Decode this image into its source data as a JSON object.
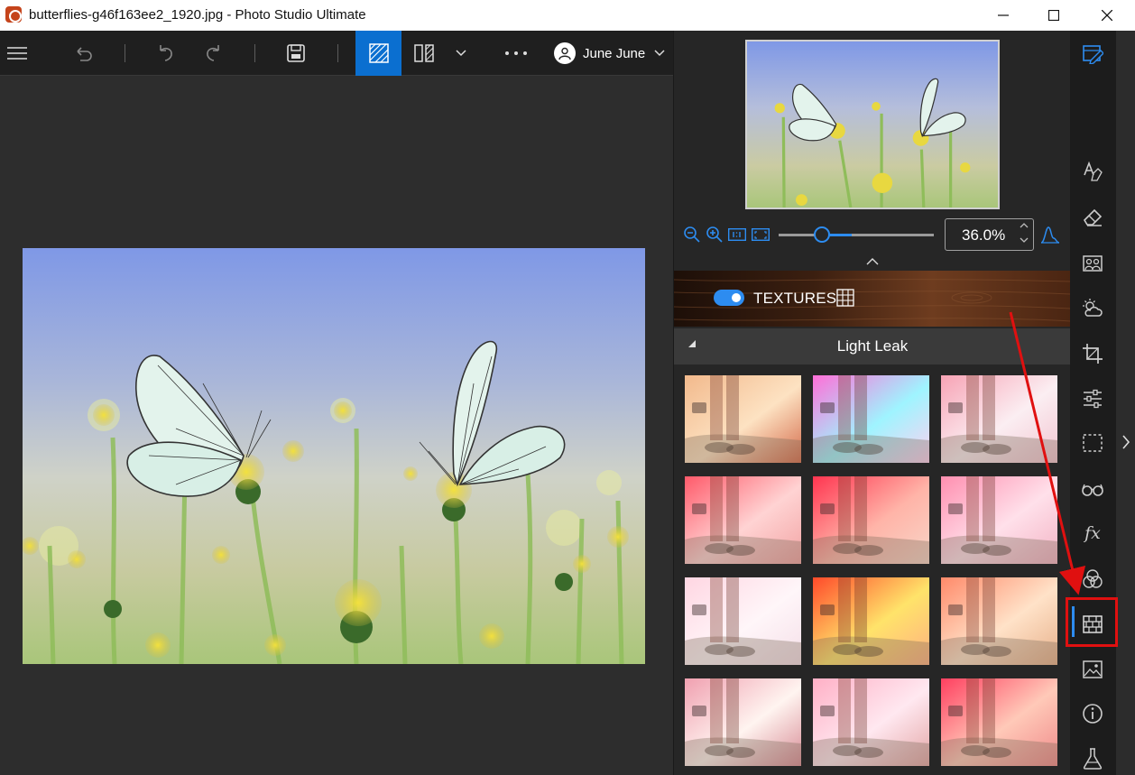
{
  "window": {
    "title": "butterflies-g46f163ee2_1920.jpg - Photo Studio Ultimate",
    "app_icon": "app-logo-icon",
    "controls": [
      "minimize-icon",
      "maximize-icon",
      "close-icon"
    ]
  },
  "toolbar": {
    "buttons": [
      "menu-icon",
      "undo-all-icon",
      "undo-icon",
      "redo-icon",
      "save-icon",
      "single-view-icon",
      "compare-view-icon",
      "chevron-down-icon",
      "more-icon"
    ],
    "active_button": "single-view-icon",
    "user_name": "June June"
  },
  "zoom": {
    "value_text": "36.0%",
    "level": 0.36,
    "buttons": [
      "zoom-out-icon",
      "zoom-in-icon",
      "actual-size-icon",
      "fit-screen-icon",
      "histogram-icon"
    ]
  },
  "textures": {
    "label": "TEXTURES",
    "enabled": true,
    "category": "Light Leak",
    "thumbnail_count": 12
  },
  "rail": {
    "items": [
      "edit-icon",
      "text-icon",
      "eraser-icon",
      "portrait-icon",
      "weather-icon",
      "crop-icon",
      "adjust-sliders-icon",
      "selection-icon",
      "glasses-icon",
      "fx-icon",
      "color-circles-icon",
      "textures-icon",
      "image-icon",
      "info-icon",
      "lab-flask-icon"
    ],
    "active": "textures-icon",
    "expand_icon": "chevron-right-icon"
  },
  "colors": {
    "accent": "#2d8cf0",
    "highlight": "#e01010",
    "panel": "#262626"
  }
}
